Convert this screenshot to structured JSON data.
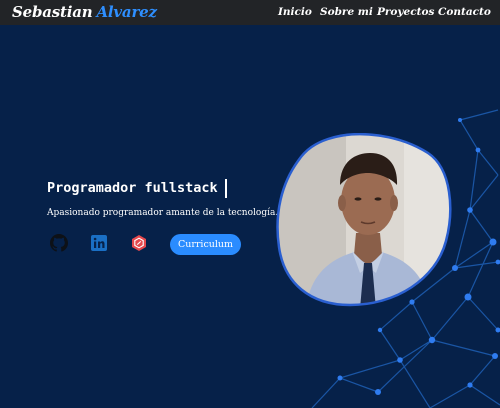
{
  "navbar": {
    "brand_first": "Sebastian",
    "brand_second": "Alvarez",
    "links": [
      "Inicio",
      "Sobre mi",
      "Proyectos",
      "Contacto"
    ]
  },
  "hero": {
    "headline": "Programador fullstack",
    "tagline": "Apasionado programador amante de la tecnología.",
    "cv_button": "Curriculum",
    "social_icons": [
      "github-icon",
      "linkedin-icon",
      "portfolio-hexagon-icon"
    ]
  },
  "colors": {
    "background": "#062149",
    "navbar": "#222427",
    "accent": "#2a8cff",
    "hexagon_icon": "#e5484d"
  }
}
